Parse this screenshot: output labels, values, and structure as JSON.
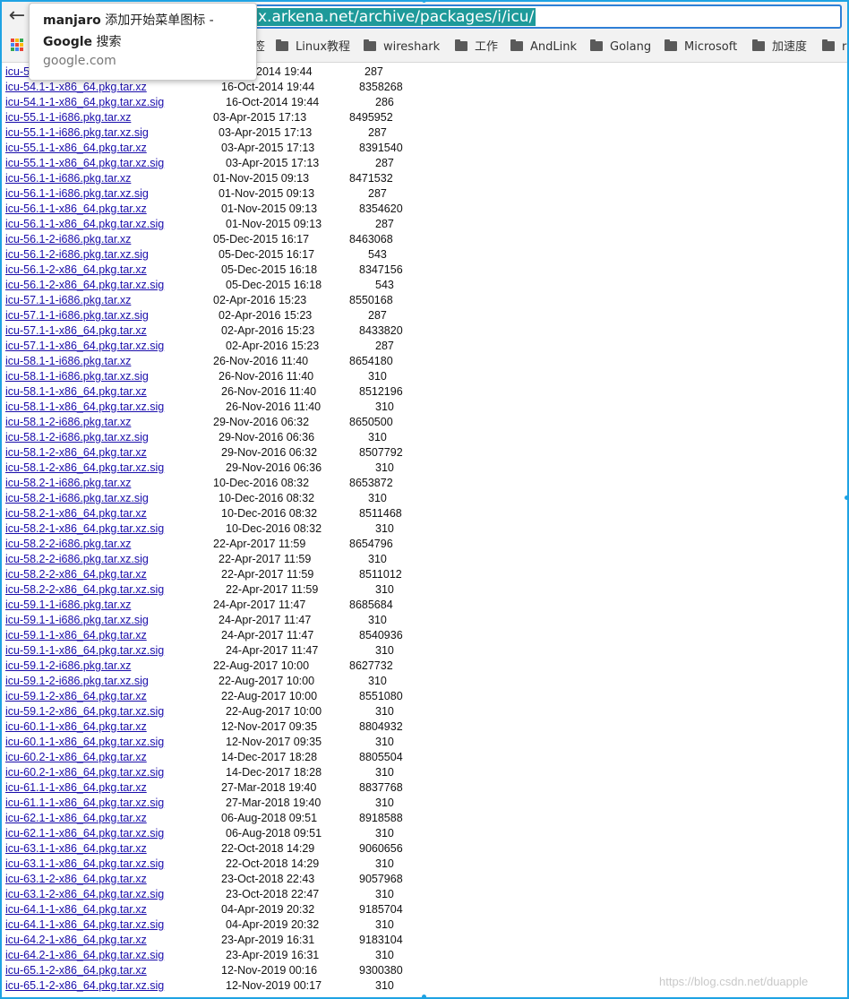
{
  "browser": {
    "url": "x.arkena.net/archive/packages/i/icu/",
    "back_glyph": "←",
    "accent_color": "#2f7fd6",
    "selection_color": "#1e9a9a"
  },
  "bookmarks": [
    {
      "label": "签"
    },
    {
      "label": "Linux教程"
    },
    {
      "label": "wireshark"
    },
    {
      "label": "工作"
    },
    {
      "label": "AndLink"
    },
    {
      "label": "Golang"
    },
    {
      "label": "Microsoft"
    },
    {
      "label": "加速度"
    },
    {
      "label": "r"
    }
  ],
  "suggestion": {
    "app": "manjaro",
    "text": " 添加开始菜单图标 -",
    "engine": "Google",
    "engine_suffix": " 搜索",
    "domain": "google.com"
  },
  "files": [
    {
      "name": "icu-5",
      "date": "2014 19:44",
      "size": "287"
    },
    {
      "name": "icu-54.1-1-x86_64.pkg.tar.xz",
      "date": "16-Oct-2014 19:44",
      "size": "8358268"
    },
    {
      "name": "icu-54.1-1-x86_64.pkg.tar.xz.sig",
      "date": "16-Oct-2014 19:44",
      "size": "286"
    },
    {
      "name": "icu-55.1-1-i686.pkg.tar.xz",
      "date": "03-Apr-2015 17:13",
      "size": "8495952"
    },
    {
      "name": "icu-55.1-1-i686.pkg.tar.xz.sig",
      "date": "03-Apr-2015 17:13",
      "size": "287"
    },
    {
      "name": "icu-55.1-1-x86_64.pkg.tar.xz",
      "date": "03-Apr-2015 17:13",
      "size": "8391540"
    },
    {
      "name": "icu-55.1-1-x86_64.pkg.tar.xz.sig",
      "date": "03-Apr-2015 17:13",
      "size": "287"
    },
    {
      "name": "icu-56.1-1-i686.pkg.tar.xz",
      "date": "01-Nov-2015 09:13",
      "size": "8471532"
    },
    {
      "name": "icu-56.1-1-i686.pkg.tar.xz.sig",
      "date": "01-Nov-2015 09:13",
      "size": "287"
    },
    {
      "name": "icu-56.1-1-x86_64.pkg.tar.xz",
      "date": "01-Nov-2015 09:13",
      "size": "8354620"
    },
    {
      "name": "icu-56.1-1-x86_64.pkg.tar.xz.sig",
      "date": "01-Nov-2015 09:13",
      "size": "287"
    },
    {
      "name": "icu-56.1-2-i686.pkg.tar.xz",
      "date": "05-Dec-2015 16:17",
      "size": "8463068"
    },
    {
      "name": "icu-56.1-2-i686.pkg.tar.xz.sig",
      "date": "05-Dec-2015 16:17",
      "size": "543"
    },
    {
      "name": "icu-56.1-2-x86_64.pkg.tar.xz",
      "date": "05-Dec-2015 16:18",
      "size": "8347156"
    },
    {
      "name": "icu-56.1-2-x86_64.pkg.tar.xz.sig",
      "date": "05-Dec-2015 16:18",
      "size": "543"
    },
    {
      "name": "icu-57.1-1-i686.pkg.tar.xz",
      "date": "02-Apr-2016 15:23",
      "size": "8550168"
    },
    {
      "name": "icu-57.1-1-i686.pkg.tar.xz.sig",
      "date": "02-Apr-2016 15:23",
      "size": "287"
    },
    {
      "name": "icu-57.1-1-x86_64.pkg.tar.xz",
      "date": "02-Apr-2016 15:23",
      "size": "8433820"
    },
    {
      "name": "icu-57.1-1-x86_64.pkg.tar.xz.sig",
      "date": "02-Apr-2016 15:23",
      "size": "287"
    },
    {
      "name": "icu-58.1-1-i686.pkg.tar.xz",
      "date": "26-Nov-2016 11:40",
      "size": "8654180"
    },
    {
      "name": "icu-58.1-1-i686.pkg.tar.xz.sig",
      "date": "26-Nov-2016 11:40",
      "size": "310"
    },
    {
      "name": "icu-58.1-1-x86_64.pkg.tar.xz",
      "date": "26-Nov-2016 11:40",
      "size": "8512196"
    },
    {
      "name": "icu-58.1-1-x86_64.pkg.tar.xz.sig",
      "date": "26-Nov-2016 11:40",
      "size": "310"
    },
    {
      "name": "icu-58.1-2-i686.pkg.tar.xz",
      "date": "29-Nov-2016 06:32",
      "size": "8650500"
    },
    {
      "name": "icu-58.1-2-i686.pkg.tar.xz.sig",
      "date": "29-Nov-2016 06:36",
      "size": "310"
    },
    {
      "name": "icu-58.1-2-x86_64.pkg.tar.xz",
      "date": "29-Nov-2016 06:32",
      "size": "8507792"
    },
    {
      "name": "icu-58.1-2-x86_64.pkg.tar.xz.sig",
      "date": "29-Nov-2016 06:36",
      "size": "310"
    },
    {
      "name": "icu-58.2-1-i686.pkg.tar.xz",
      "date": "10-Dec-2016 08:32",
      "size": "8653872"
    },
    {
      "name": "icu-58.2-1-i686.pkg.tar.xz.sig",
      "date": "10-Dec-2016 08:32",
      "size": "310"
    },
    {
      "name": "icu-58.2-1-x86_64.pkg.tar.xz",
      "date": "10-Dec-2016 08:32",
      "size": "8511468"
    },
    {
      "name": "icu-58.2-1-x86_64.pkg.tar.xz.sig",
      "date": "10-Dec-2016 08:32",
      "size": "310"
    },
    {
      "name": "icu-58.2-2-i686.pkg.tar.xz",
      "date": "22-Apr-2017 11:59",
      "size": "8654796"
    },
    {
      "name": "icu-58.2-2-i686.pkg.tar.xz.sig",
      "date": "22-Apr-2017 11:59",
      "size": "310"
    },
    {
      "name": "icu-58.2-2-x86_64.pkg.tar.xz",
      "date": "22-Apr-2017 11:59",
      "size": "8511012"
    },
    {
      "name": "icu-58.2-2-x86_64.pkg.tar.xz.sig",
      "date": "22-Apr-2017 11:59",
      "size": "310"
    },
    {
      "name": "icu-59.1-1-i686.pkg.tar.xz",
      "date": "24-Apr-2017 11:47",
      "size": "8685684"
    },
    {
      "name": "icu-59.1-1-i686.pkg.tar.xz.sig",
      "date": "24-Apr-2017 11:47",
      "size": "310"
    },
    {
      "name": "icu-59.1-1-x86_64.pkg.tar.xz",
      "date": "24-Apr-2017 11:47",
      "size": "8540936"
    },
    {
      "name": "icu-59.1-1-x86_64.pkg.tar.xz.sig",
      "date": "24-Apr-2017 11:47",
      "size": "310"
    },
    {
      "name": "icu-59.1-2-i686.pkg.tar.xz",
      "date": "22-Aug-2017 10:00",
      "size": "8627732"
    },
    {
      "name": "icu-59.1-2-i686.pkg.tar.xz.sig",
      "date": "22-Aug-2017 10:00",
      "size": "310"
    },
    {
      "name": "icu-59.1-2-x86_64.pkg.tar.xz",
      "date": "22-Aug-2017 10:00",
      "size": "8551080"
    },
    {
      "name": "icu-59.1-2-x86_64.pkg.tar.xz.sig",
      "date": "22-Aug-2017 10:00",
      "size": "310"
    },
    {
      "name": "icu-60.1-1-x86_64.pkg.tar.xz",
      "date": "12-Nov-2017 09:35",
      "size": "8804932"
    },
    {
      "name": "icu-60.1-1-x86_64.pkg.tar.xz.sig",
      "date": "12-Nov-2017 09:35",
      "size": "310"
    },
    {
      "name": "icu-60.2-1-x86_64.pkg.tar.xz",
      "date": "14-Dec-2017 18:28",
      "size": "8805504"
    },
    {
      "name": "icu-60.2-1-x86_64.pkg.tar.xz.sig",
      "date": "14-Dec-2017 18:28",
      "size": "310"
    },
    {
      "name": "icu-61.1-1-x86_64.pkg.tar.xz",
      "date": "27-Mar-2018 19:40",
      "size": "8837768"
    },
    {
      "name": "icu-61.1-1-x86_64.pkg.tar.xz.sig",
      "date": "27-Mar-2018 19:40",
      "size": "310"
    },
    {
      "name": "icu-62.1-1-x86_64.pkg.tar.xz",
      "date": "06-Aug-2018 09:51",
      "size": "8918588"
    },
    {
      "name": "icu-62.1-1-x86_64.pkg.tar.xz.sig",
      "date": "06-Aug-2018 09:51",
      "size": "310"
    },
    {
      "name": "icu-63.1-1-x86_64.pkg.tar.xz",
      "date": "22-Oct-2018 14:29",
      "size": "9060656"
    },
    {
      "name": "icu-63.1-1-x86_64.pkg.tar.xz.sig",
      "date": "22-Oct-2018 14:29",
      "size": "310"
    },
    {
      "name": "icu-63.1-2-x86_64.pkg.tar.xz",
      "date": "23-Oct-2018 22:43",
      "size": "9057968"
    },
    {
      "name": "icu-63.1-2-x86_64.pkg.tar.xz.sig",
      "date": "23-Oct-2018 22:47",
      "size": "310"
    },
    {
      "name": "icu-64.1-1-x86_64.pkg.tar.xz",
      "date": "04-Apr-2019 20:32",
      "size": "9185704"
    },
    {
      "name": "icu-64.1-1-x86_64.pkg.tar.xz.sig",
      "date": "04-Apr-2019 20:32",
      "size": "310"
    },
    {
      "name": "icu-64.2-1-x86_64.pkg.tar.xz",
      "date": "23-Apr-2019 16:31",
      "size": "9183104"
    },
    {
      "name": "icu-64.2-1-x86_64.pkg.tar.xz.sig",
      "date": "23-Apr-2019 16:31",
      "size": "310"
    },
    {
      "name": "icu-65.1-2-x86_64.pkg.tar.xz",
      "date": "12-Nov-2019 00:16",
      "size": "9300380"
    },
    {
      "name": "icu-65.1-2-x86_64.pkg.tar.xz.sig",
      "date": "12-Nov-2019 00:17",
      "size": "310"
    }
  ],
  "watermark": "https://blog.csdn.net/duapple"
}
